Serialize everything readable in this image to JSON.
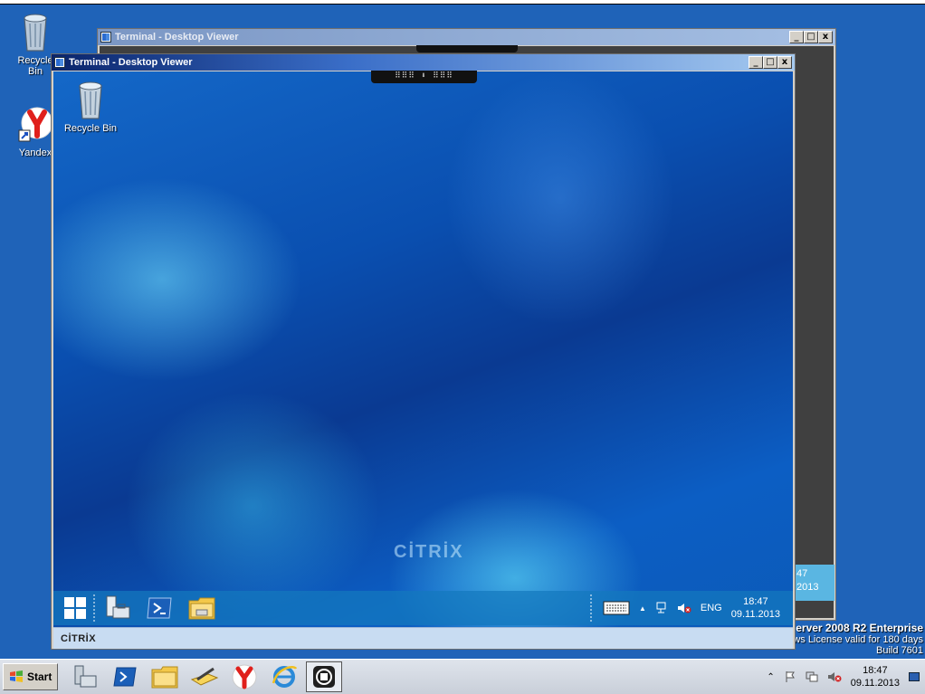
{
  "host_desktop": {
    "icons": [
      {
        "label": "Recycle Bin",
        "icon": "recycle-bin-icon"
      },
      {
        "label": "Yandex",
        "icon": "yandex-browser-icon"
      }
    ],
    "watermark": {
      "line1": "erver 2008 R2 Enterprise",
      "line2": "ws License valid for 180 days",
      "line3": "Build 7601"
    }
  },
  "back_window": {
    "title": "Terminal - Desktop Viewer",
    "clock_time": "47",
    "clock_date": "2013"
  },
  "front_window": {
    "title": "Terminal - Desktop Viewer",
    "buttons": {
      "minimize": "_",
      "maximize": "□",
      "close": "x"
    },
    "dragbar_label": "⠿⠿⠿ ⬇ ⠿⠿⠿",
    "inner_desktop": {
      "icons": [
        {
          "label": "Recycle Bin",
          "icon": "recycle-bin-icon"
        }
      ],
      "brand_text": "CİTRİX"
    },
    "inner_taskbar": {
      "items": [
        "windows-start-icon",
        "server-manager-icon",
        "powershell-icon",
        "file-explorer-icon"
      ],
      "tray": {
        "keyboard": "keyboard-icon",
        "chevron": "▲",
        "network": "network-icon",
        "volume": "volume-muted-icon",
        "language": "ENG",
        "time": "18:47",
        "date": "09.11.2013"
      }
    },
    "status_bar": {
      "logo": "CİTRİX"
    }
  },
  "host_taskbar": {
    "start_label": "Start",
    "items": [
      "server-manager-icon",
      "powershell-icon",
      "file-explorer-icon",
      "folder-pen-icon",
      "yandex-browser-icon",
      "internet-explorer-icon",
      "citrix-receiver-icon"
    ],
    "tray": {
      "time": "18:47",
      "date": "09.11.2013"
    }
  },
  "colors": {
    "host_bg": "#1f63b8",
    "front_title": "#0a246a",
    "citrix_status_bg": "#c8dcf2"
  }
}
